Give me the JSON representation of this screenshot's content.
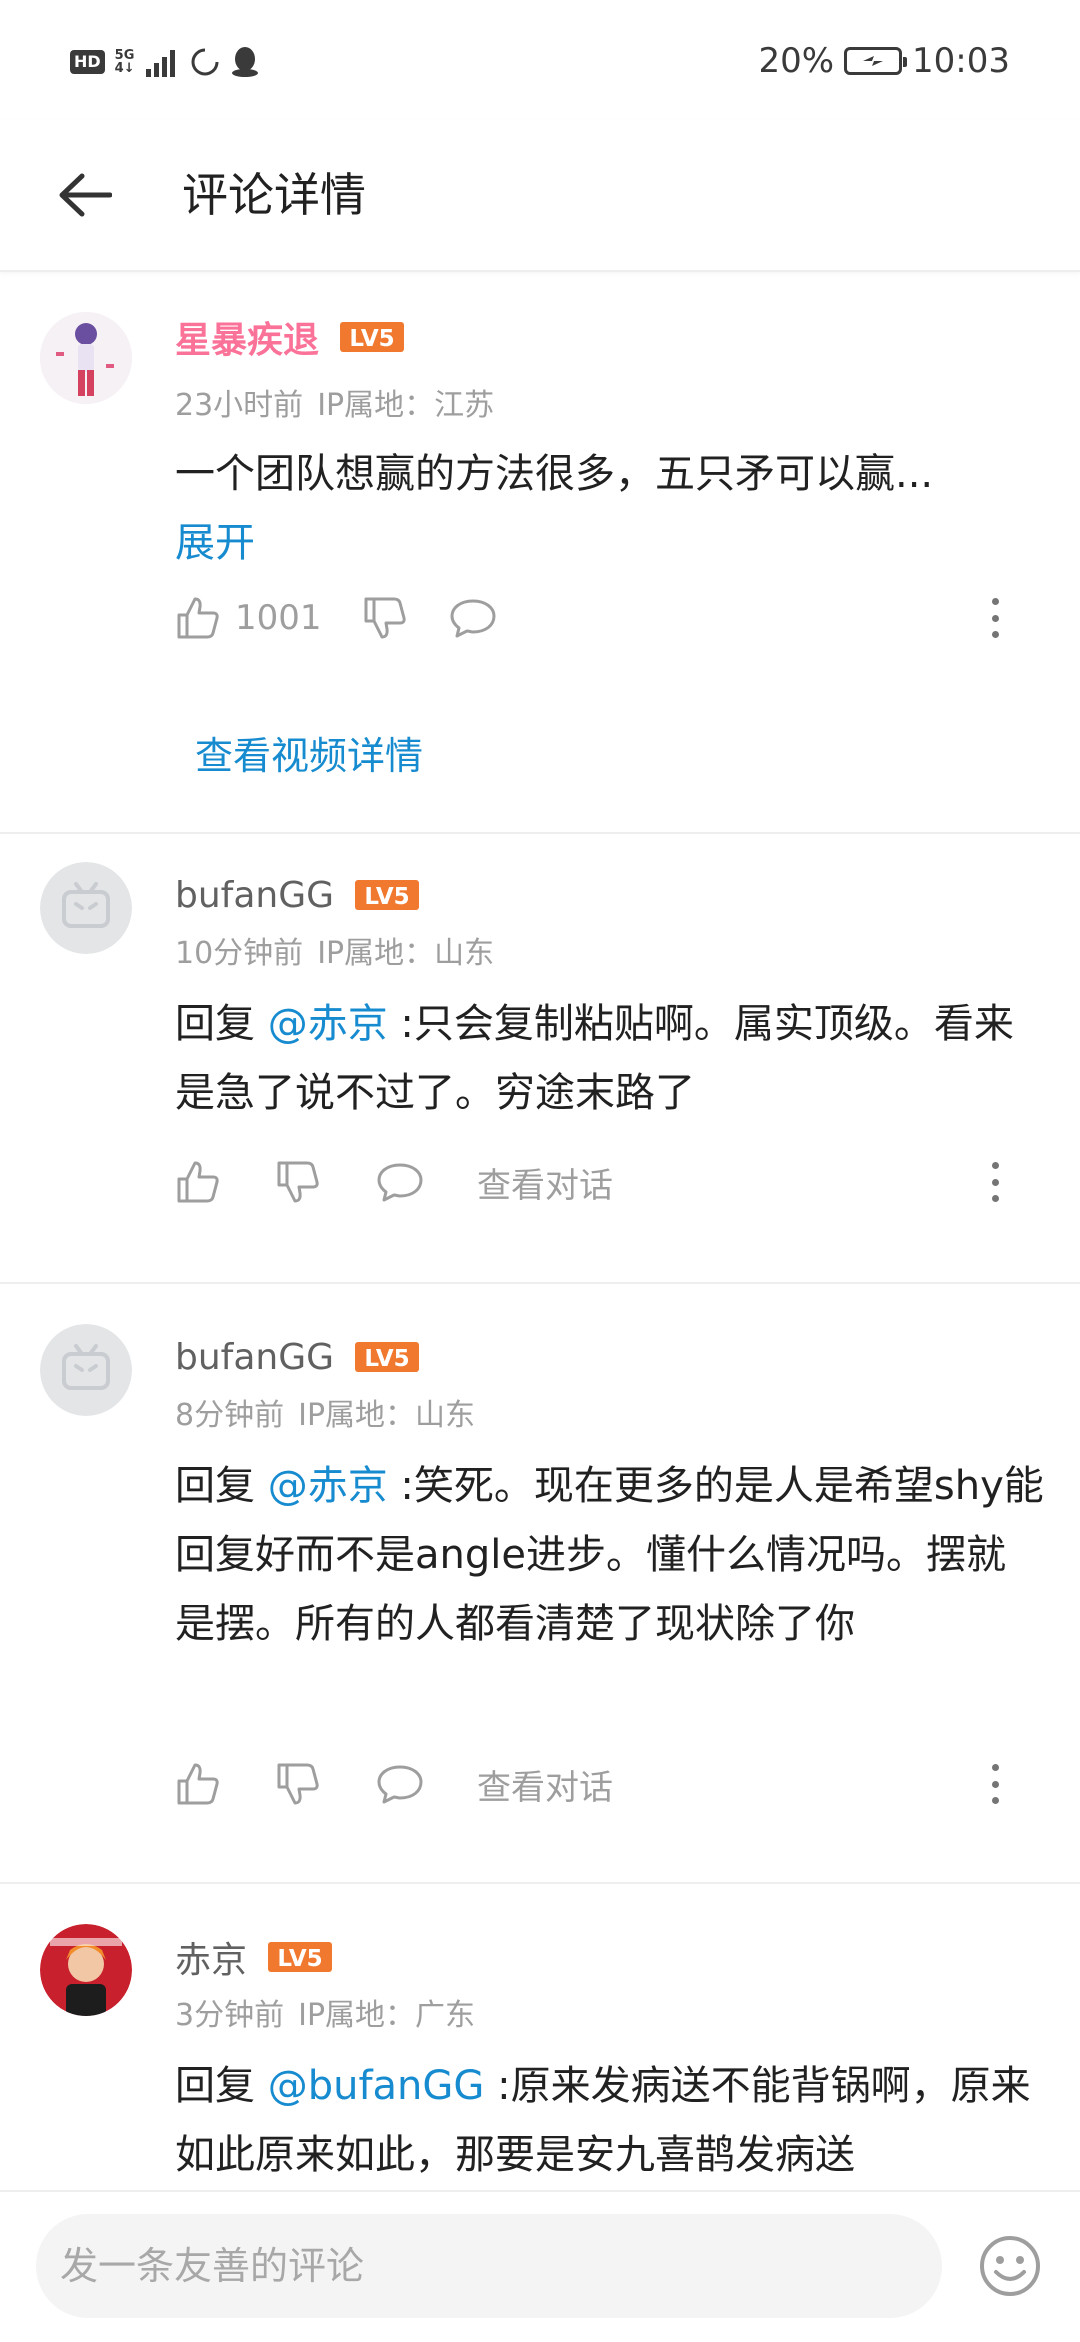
{
  "status_bar": {
    "hd": "HD",
    "net_top": "5G",
    "net_bottom": "4↓",
    "battery_percent": "20%",
    "time": "10:03"
  },
  "header": {
    "title": "评论详情"
  },
  "main_comment": {
    "username": "星暴疾退",
    "level": "LV5",
    "time": "23小时前",
    "ip": "IP属地：江苏",
    "content": "一个团队想赢的方法很多，五只矛可以赢...",
    "expand": "展开",
    "likes": "1001",
    "view_video": "查看视频详情"
  },
  "replies": [
    {
      "username": "bufanGG",
      "level": "LV5",
      "time": "10分钟前",
      "ip": "IP属地：山东",
      "reply_prefix": "回复 ",
      "mention": "@赤京",
      "content": " :只会复制粘贴啊。属实顶级。看来是急了说不过了。穷途末路了",
      "view_conversation": "查看对话"
    },
    {
      "username": "bufanGG",
      "level": "LV5",
      "time": "8分钟前",
      "ip": "IP属地：山东",
      "reply_prefix": "回复 ",
      "mention": "@赤京",
      "content": " :笑死。现在更多的是人是希望shy能回复好而不是angle进步。懂什么情况吗。摆就是摆。所有的人都看清楚了现状除了你",
      "view_conversation": "查看对话"
    },
    {
      "username": "赤京",
      "level": "LV5",
      "time": "3分钟前",
      "ip": "IP属地：广东",
      "reply_prefix": "回复 ",
      "mention": "@bufanGG",
      "content": " :原来发病送不能背锅啊，原来如此原来如此，那要是安九喜鹊发病送"
    }
  ],
  "bottom_bar": {
    "placeholder": "发一条友善的评论"
  },
  "colors": {
    "link": "#178bcf",
    "vip_name": "#fb7299",
    "level_badge": "#f0792f"
  },
  "icons": [
    "back-arrow-icon",
    "thumb-up-icon",
    "thumb-down-icon",
    "reply-bubble-icon",
    "more-vertical-icon",
    "emoji-icon"
  ]
}
